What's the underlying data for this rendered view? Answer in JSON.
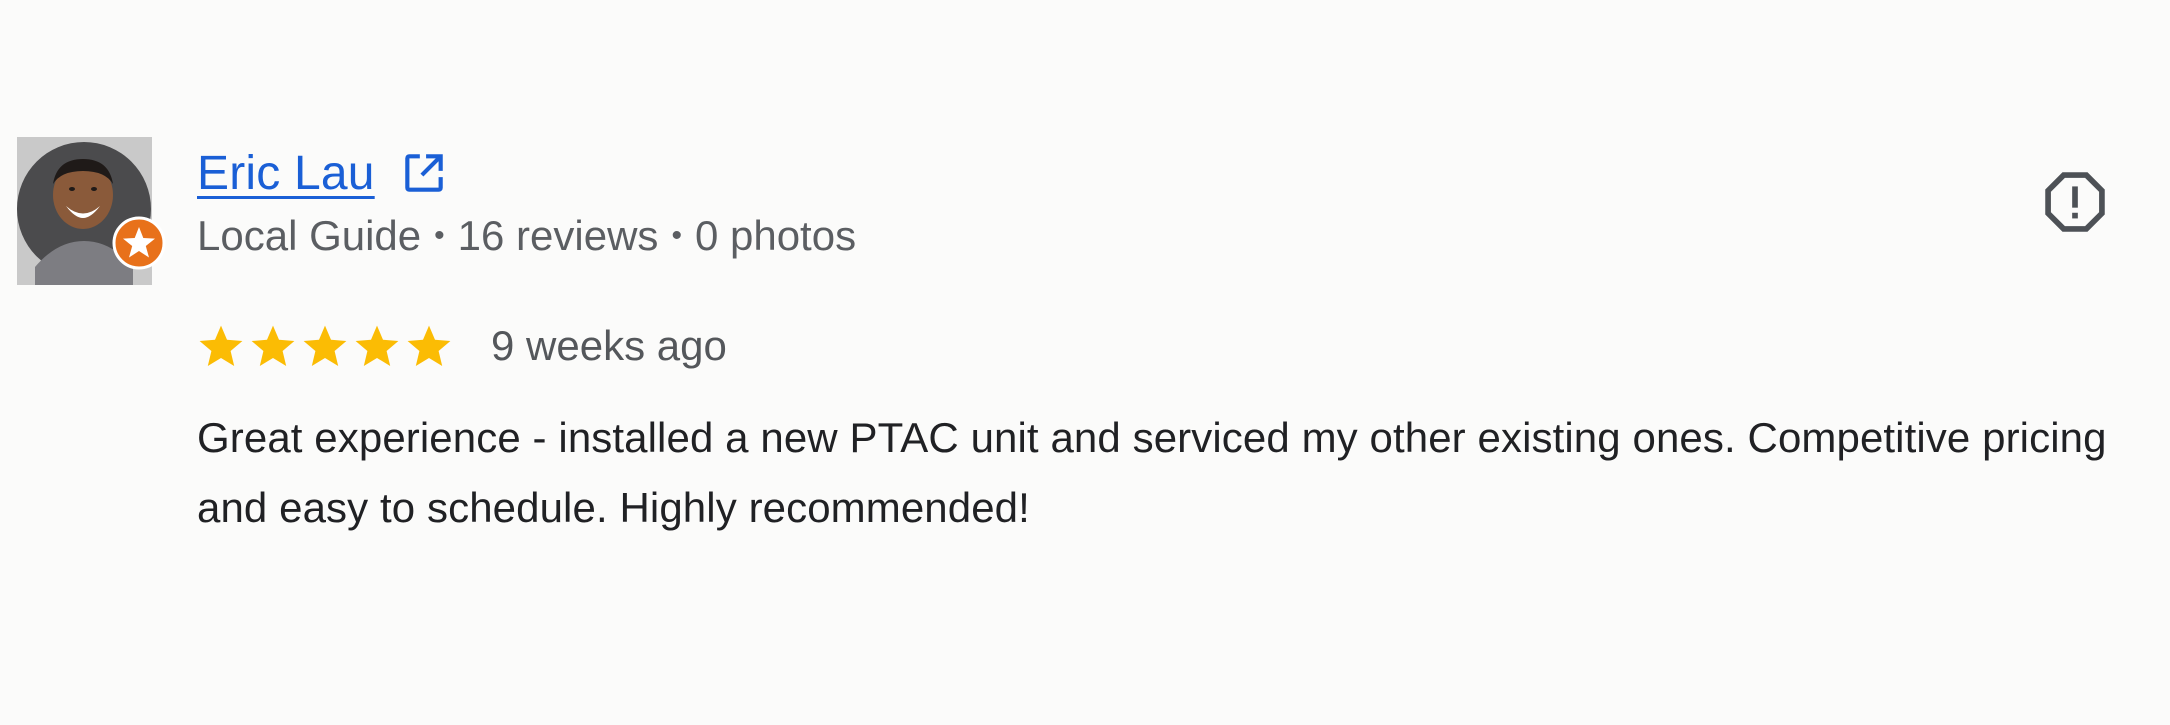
{
  "review": {
    "author": {
      "name": "Eric Lau",
      "badge": "Local Guide",
      "reviews_count": "16 reviews",
      "photos_count": "0 photos"
    },
    "meta_separator": "•",
    "rating": {
      "value": 5,
      "max": 5,
      "color": "#fbbc04"
    },
    "date": "9 weeks ago",
    "text": "Great experience - installed a new PTAC unit and serviced my other existing ones. Competitive pricing and easy to schedule. Highly recommended!"
  },
  "icons": {
    "open_profile": "external-link-icon",
    "report": "report-review-icon",
    "local_guide": "local-guide-star-badge-icon",
    "star": "star-icon"
  },
  "colors": {
    "link": "#1a5fd6",
    "secondary_text": "#5b5e62",
    "body_text": "#202124",
    "badge": "#e8711a",
    "background": "#fbfbfa"
  }
}
